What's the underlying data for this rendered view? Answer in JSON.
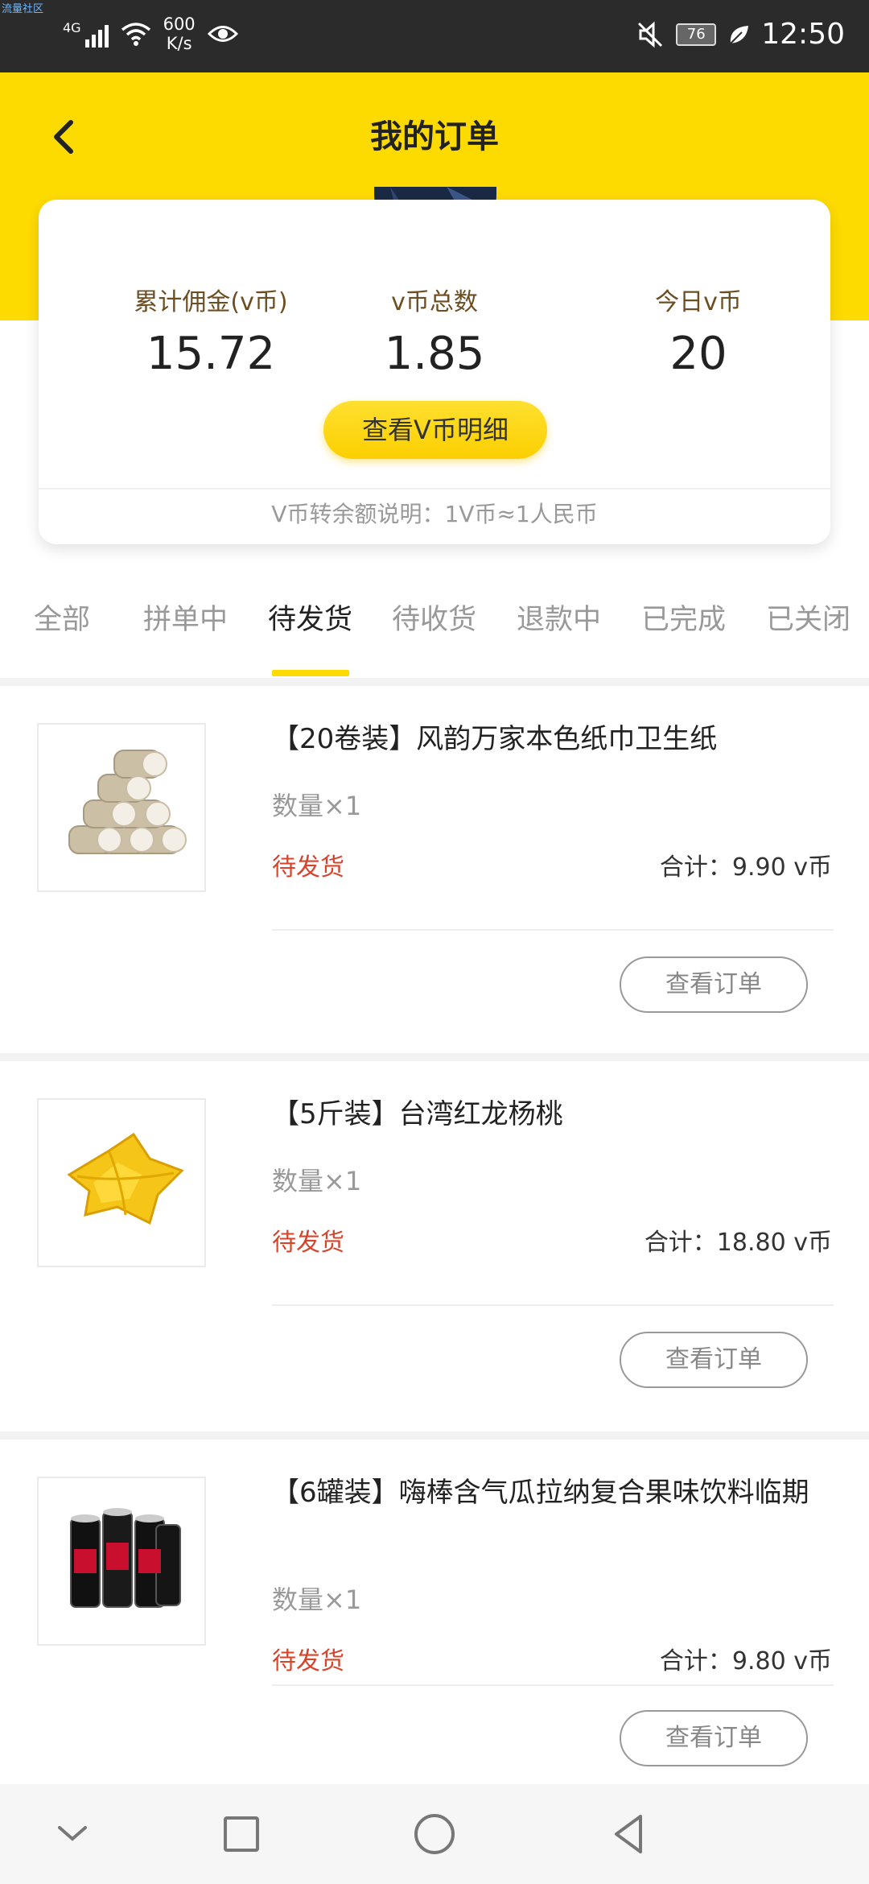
{
  "status_bar": {
    "corner_tag": "流量社区",
    "network": "4G",
    "speed_value": "600",
    "speed_unit": "K/s",
    "battery": "76",
    "time": "12:50"
  },
  "header": {
    "title": "我的订单",
    "back_icon": "chevron-left-icon"
  },
  "summary": {
    "stats": [
      {
        "label": "累计佣金(v币)",
        "value": "15.72"
      },
      {
        "label": "v币总数",
        "value": "1.85"
      },
      {
        "label": "今日v币",
        "value": "20"
      }
    ],
    "detail_button": "查看V币明细",
    "note": "V币转余额说明：1V币≈1人民币"
  },
  "tabs": [
    {
      "label": "全部"
    },
    {
      "label": "拼单中"
    },
    {
      "label": "待发货",
      "active": true
    },
    {
      "label": "待收货"
    },
    {
      "label": "退款中"
    },
    {
      "label": "已完成"
    },
    {
      "label": "已关闭"
    }
  ],
  "orders": [
    {
      "title": "【20卷装】风韵万家本色纸巾卫生纸",
      "qty": "数量×1",
      "status": "待发货",
      "total": "合计：9.90 v币",
      "button": "查看订单",
      "image": "toilet-paper-rolls"
    },
    {
      "title": "【5斤装】台湾红龙杨桃",
      "qty": "数量×1",
      "status": "待发货",
      "total": "合计：18.80 v币",
      "button": "查看订单",
      "image": "star-fruit"
    },
    {
      "title": "【6罐装】嗨棒含气瓜拉纳复合果味饮料临期",
      "qty": "数量×1",
      "status": "待发货",
      "total": "合计：9.80 v币",
      "button": "查看订单",
      "image": "drink-cans"
    }
  ],
  "colors": {
    "accent": "#fedb00",
    "status_red": "#d6452b",
    "label_brown": "#6b4e22"
  }
}
